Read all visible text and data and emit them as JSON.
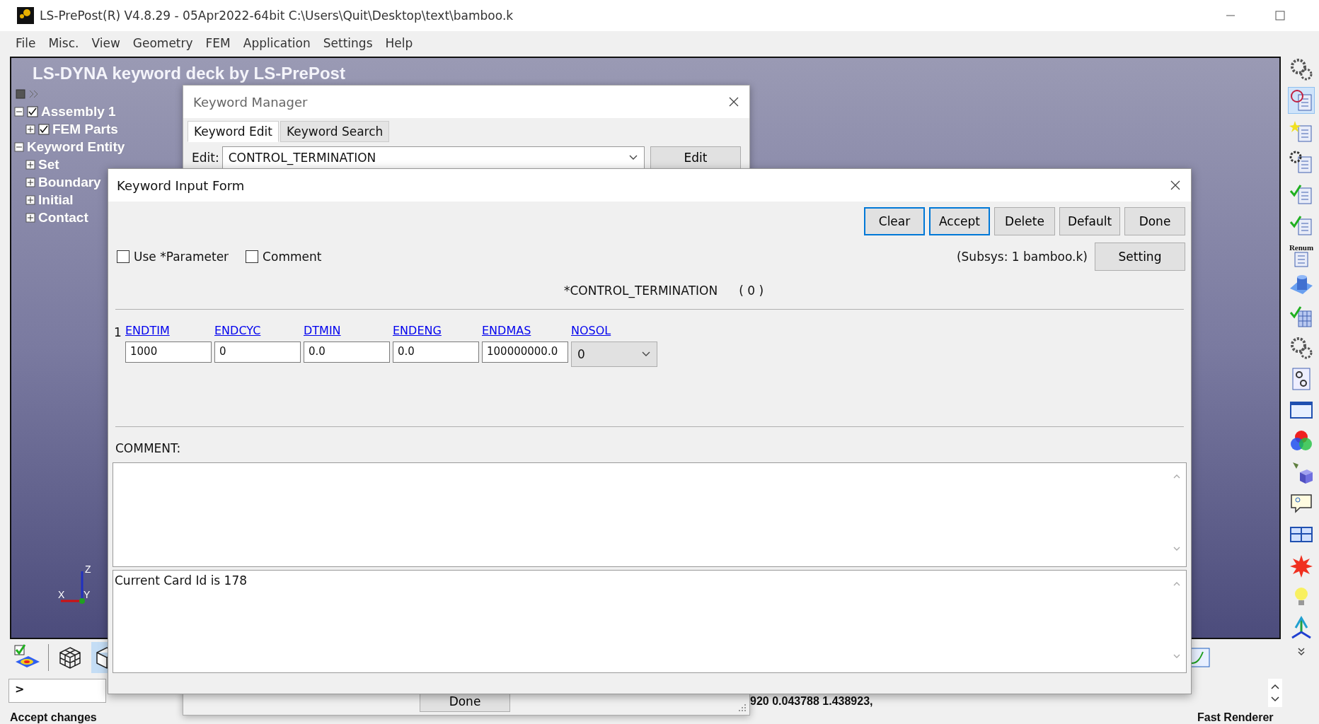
{
  "window": {
    "title": "LS-PrePost(R) V4.8.29 - 05Apr2022-64bit C:\\Users\\Quit\\Desktop\\text\\bamboo.k"
  },
  "menu": [
    "File",
    "Misc.",
    "View",
    "Geometry",
    "FEM",
    "Application",
    "Settings",
    "Help"
  ],
  "viewport": {
    "title": "LS-DYNA keyword deck by LS-PrePost",
    "axes": [
      "Z",
      "X",
      "Y"
    ],
    "tree": [
      {
        "label": "Assembly 1",
        "checked": true,
        "expanded": true,
        "children": [
          {
            "label": "FEM Parts",
            "checked": true,
            "expanded": false
          }
        ]
      },
      {
        "label": "Keyword Entity",
        "expanded": true,
        "children": [
          {
            "label": "Set",
            "expanded": false
          },
          {
            "label": "Boundary",
            "expanded": false
          },
          {
            "label": "Initial",
            "expanded": false
          },
          {
            "label": "Contact",
            "expanded": false
          }
        ]
      }
    ]
  },
  "right_toolbar": {
    "renum_label": "Renum"
  },
  "view_modes": [
    {
      "selected": false
    },
    {
      "selected": false
    },
    {
      "selected": true
    }
  ],
  "keyword_manager": {
    "title": "Keyword Manager",
    "tabs": [
      {
        "label": "Keyword Edit",
        "selected": true
      },
      {
        "label": "Keyword Search",
        "selected": false
      }
    ],
    "edit_label": "Edit:",
    "edit_value": "CONTROL_TERMINATION",
    "edit_button": "Edit",
    "done_button": "Done"
  },
  "input_form": {
    "title": "Keyword Input Form",
    "buttons": [
      {
        "label": "Clear",
        "highlighted": true
      },
      {
        "label": "Accept",
        "highlighted": true
      },
      {
        "label": "Delete",
        "highlighted": false
      },
      {
        "label": "Default",
        "highlighted": false
      },
      {
        "label": "Done",
        "highlighted": false
      }
    ],
    "options": [
      {
        "label": "Use *Parameter",
        "checked": false
      },
      {
        "label": "Comment",
        "checked": false
      }
    ],
    "subsys": "(Subsys: 1 bamboo.k)",
    "setting_button": "Setting",
    "heading": "*CONTROL_TERMINATION",
    "count": "( 0 )",
    "card_number": "1",
    "fields": [
      {
        "label": "ENDTIM",
        "value": "1000",
        "kind": "text"
      },
      {
        "label": "ENDCYC",
        "value": "0",
        "kind": "text"
      },
      {
        "label": "DTMIN",
        "value": "0.0",
        "kind": "text"
      },
      {
        "label": "ENDENG",
        "value": "0.0",
        "kind": "text"
      },
      {
        "label": "ENDMAS",
        "value": "100000000.0",
        "kind": "text"
      },
      {
        "label": "NOSOL",
        "value": "0",
        "kind": "select"
      }
    ],
    "comment_label": "COMMENT:",
    "message": "Current Card Id is 178"
  },
  "command": {
    "prompt": ">"
  },
  "output_line": "920 0.043788 1.438923,",
  "status": "Accept changes",
  "renderer": "Fast Renderer"
}
